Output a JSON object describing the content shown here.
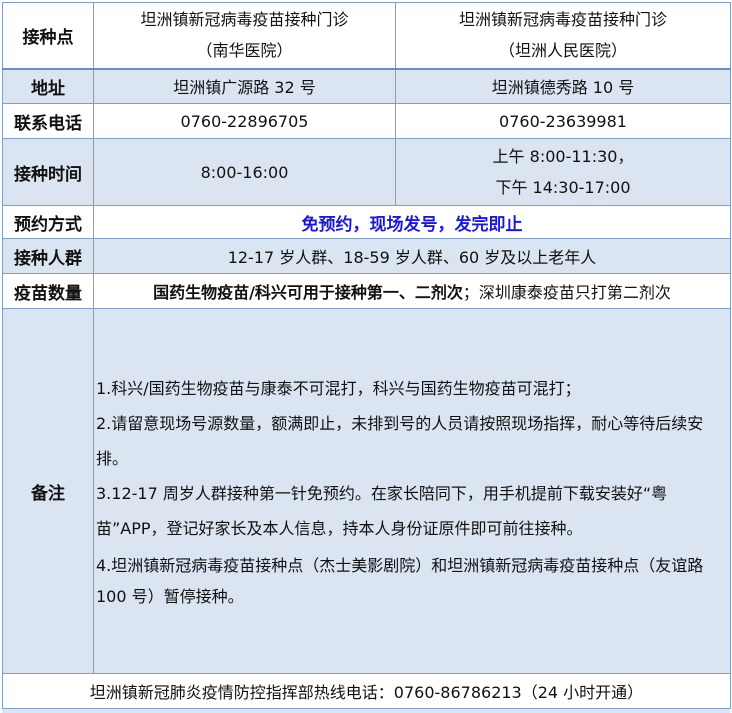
{
  "rows": {
    "site": {
      "label": "接种点",
      "col1": [
        "坦洲镇新冠病毒疫苗接种门诊",
        "（南华医院）"
      ],
      "col2": [
        "坦洲镇新冠病毒疫苗接种门诊",
        "（坦洲人民医院）"
      ]
    },
    "address": {
      "label": "地址",
      "col1": "坦洲镇广源路 32 号",
      "col2": "坦洲镇德秀路 10 号"
    },
    "phone": {
      "label": "联系电话",
      "col1": "0760-22896705",
      "col2": "0760-23639981"
    },
    "time": {
      "label": "接种时间",
      "col1": "8:00-16:00",
      "col2": [
        "上午 8:00-11:30，",
        "下午 14:30-17:00"
      ]
    },
    "booking": {
      "label": "预约方式",
      "value": "免预约，现场发号，发完即止"
    },
    "population": {
      "label": "接种人群",
      "value": "12-17 岁人群、18-59 岁人群、60 岁及以上老年人"
    },
    "vaccine": {
      "label": "疫苗数量",
      "bold_part": "国药生物疫苗/科兴可用于接种第一、二剂次",
      "rest": "；深圳康泰疫苗只打第二剂次"
    },
    "notes": {
      "label": "备注",
      "items": [
        "1.科兴/国药生物疫苗与康泰不可混打，科兴与国药生物疫苗可混打；",
        "2.请留意现场号源数量，额满即止，未排到号的人员请按照现场指挥，耐心等待后续安排。",
        "3.12-17 周岁人群接种第一针免预约。在家长陪同下，用手机提前下载安装好“粤苗”APP，登记好家长及本人信息，持本人身份证原件即可前往接种。",
        "4.坦洲镇新冠病毒疫苗接种点（杰士美影剧院）和坦洲镇新冠病毒疫苗接种点（友谊路 100 号）暂停接种。"
      ]
    }
  },
  "footer": "坦洲镇新冠肺炎疫情防控指挥部热线电话：0760-86786213（24 小时开通）",
  "colors": {
    "row_blue": "#dbe5f1",
    "border": "#7f9fc6",
    "highlight_text": "#1a1ad6"
  }
}
